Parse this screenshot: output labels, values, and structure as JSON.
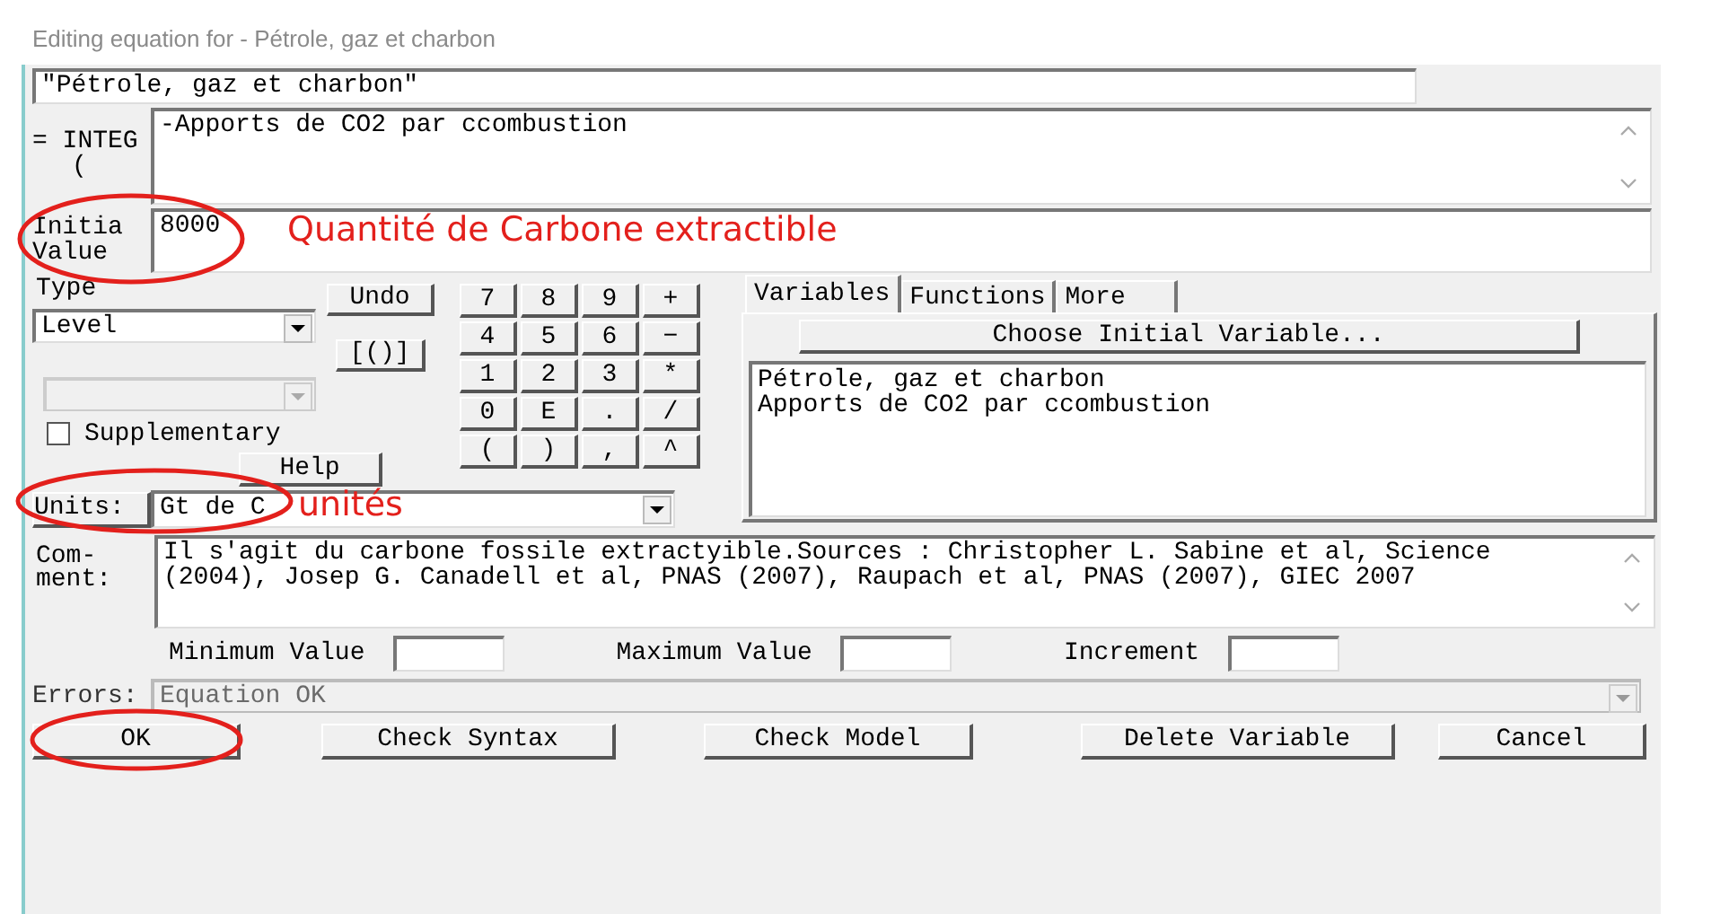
{
  "window": {
    "title": "Editing equation for - Pétrole, gaz et charbon"
  },
  "variable_name": "\"Pétrole, gaz et charbon\"",
  "equation": {
    "label": "= INTEG",
    "paren": "(",
    "value": "-Apports de CO2 par ccombustion"
  },
  "initial_value": {
    "label": "Initia Value",
    "value": "8000"
  },
  "type": {
    "label": "Type",
    "value": "Level"
  },
  "supplementary": {
    "label": "Supplementary",
    "checked": false
  },
  "undo": "Undo",
  "brackets": "[()]",
  "keypad": [
    "7",
    "8",
    "9",
    "+",
    "4",
    "5",
    "6",
    "−",
    "1",
    "2",
    "3",
    "*",
    "0",
    "E",
    ".",
    "/",
    "(",
    ")",
    ",",
    "^"
  ],
  "help": "Help",
  "tabs": [
    {
      "label": "Variables",
      "selected": true
    },
    {
      "label": "Functions",
      "selected": false
    },
    {
      "label": "More",
      "selected": false
    }
  ],
  "choose_button": "Choose Initial Variable...",
  "variables": [
    "Pétrole, gaz et charbon",
    "Apports de CO2 par ccombustion"
  ],
  "units": {
    "label": "Units:",
    "value": "Gt de C"
  },
  "comment": {
    "label": "Com- ment:",
    "value": " Il s'agit du carbone fossile extractyible.Sources : Christopher L. Sabine et al, Science (2004), Josep G. Canadell et al, PNAS (2007), Raupach et al, PNAS (2007), GIEC 2007"
  },
  "ranges": [
    "Minimum Value",
    "Maximum Value",
    "Increment"
  ],
  "errors": {
    "label": "Errors:",
    "value": "Equation OK"
  },
  "buttons": [
    "OK",
    "Check Syntax",
    "Check Model",
    "Delete Variable",
    "Cancel"
  ],
  "annotations": [
    "Quantité de Carbone extractible",
    "unités"
  ]
}
